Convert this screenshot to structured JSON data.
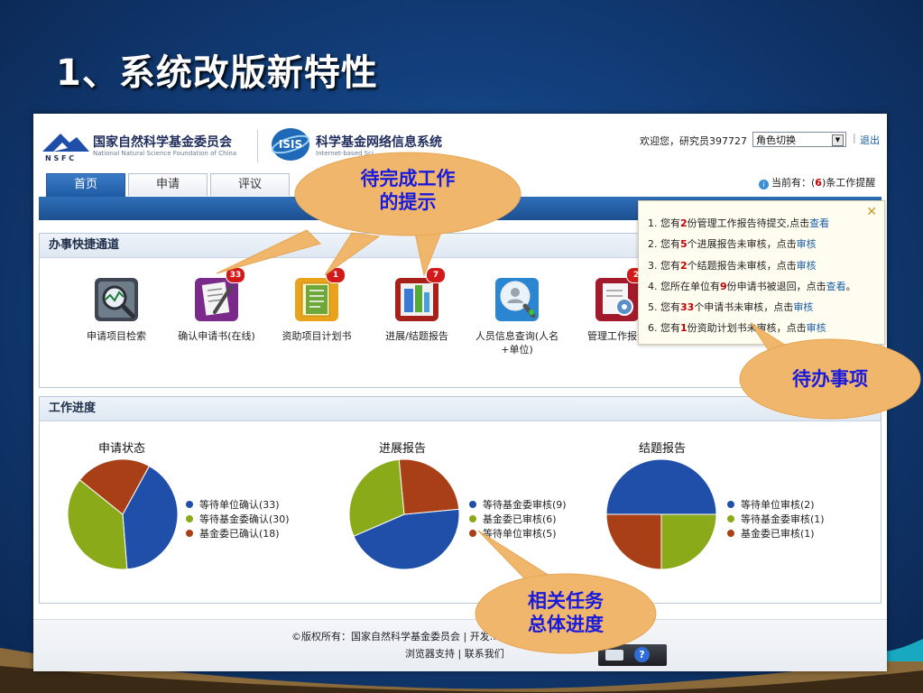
{
  "slide": {
    "title": "1、系统改版新特性"
  },
  "header": {
    "org_cn": "国家自然科学基金委员会",
    "org_en": "National Natural Science Foundation of China",
    "nsfc_label": "N S F C",
    "isis_label": "ISIS",
    "system_cn": "科学基金网络信息系统",
    "system_en": "Internet-based Sci...",
    "welcome": "欢迎您，研究员397727",
    "role_select": "角色切换",
    "logout": "退出"
  },
  "tabs": [
    {
      "label": "首页",
      "active": true
    },
    {
      "label": "申请"
    },
    {
      "label": "评议"
    }
  ],
  "reminder": {
    "prefix": "当前有：(",
    "count": "6",
    "suffix": ")条工作提醒"
  },
  "reminder_panel": {
    "items": [
      {
        "num": "1.",
        "pre": "您有",
        "n": "2",
        "post": "份管理工作报告待提交,点击",
        "link": "查看",
        "end": ""
      },
      {
        "num": "2.",
        "pre": "您有",
        "n": "5",
        "post": "个进展报告未审核，点击",
        "link": "审核",
        "end": ""
      },
      {
        "num": "3.",
        "pre": "您有",
        "n": "2",
        "post": "个结题报告未审核，点击",
        "link": "审核",
        "end": ""
      },
      {
        "num": "4.",
        "pre": "您所在单位有",
        "n": "9",
        "post": "份申请书被退回，点击",
        "link": "查看",
        "end": "。"
      },
      {
        "num": "5.",
        "pre": "您有",
        "n": "33",
        "post": "个申请书未审核，点击",
        "link": "审核",
        "end": ""
      },
      {
        "num": "6.",
        "pre": "您有",
        "n": "1",
        "post": "份资助计划书未审核，点击",
        "link": "审核",
        "end": ""
      }
    ]
  },
  "shortcuts": {
    "title": "办事快捷通道",
    "items": [
      {
        "label": "申请项目检索",
        "badge": ""
      },
      {
        "label": "确认申请书(在线)",
        "badge": "33"
      },
      {
        "label": "资助项目计划书",
        "badge": "1"
      },
      {
        "label": "进展/结题报告",
        "badge": "7"
      },
      {
        "label": "人员信息查询(人名+单位)",
        "badge": ""
      },
      {
        "label": "管理工作报告",
        "badge": "2"
      }
    ]
  },
  "progress": {
    "title": "工作进度"
  },
  "chart_data": [
    {
      "type": "pie",
      "title": "申请状态",
      "categories": [
        "等待单位确认(33)",
        "等待基金委确认(30)",
        "基金委已确认(18)"
      ],
      "values": [
        33,
        30,
        18
      ],
      "colors": [
        "#1f4fa8",
        "#8aaa1a",
        "#a83f16"
      ],
      "legend": "right"
    },
    {
      "type": "pie",
      "title": "进展报告",
      "categories": [
        "等待基金委审核(9)",
        "基金委已审核(6)",
        "等待单位审核(5)"
      ],
      "values": [
        9,
        6,
        5
      ],
      "colors": [
        "#1f4fa8",
        "#8aaa1a",
        "#a83f16"
      ],
      "legend": "right"
    },
    {
      "type": "pie",
      "title": "结题报告",
      "categories": [
        "等待单位审核(2)",
        "等待基金委审核(1)",
        "基金委已审核(1)"
      ],
      "values": [
        2,
        1,
        1
      ],
      "colors": [
        "#1f4fa8",
        "#8aaa1a",
        "#a83f16"
      ],
      "legend": "right"
    }
  ],
  "footer": {
    "copyright": "©版权所有：国家自然科学基金委员会 | 开发...",
    "browser_support": "浏览器支持",
    "divider": " | ",
    "contact": "联系我们"
  },
  "callouts": {
    "todo_tip": "待完成工作\n的提示",
    "pending": "待办事项",
    "progress": "相关任务\n总体进度"
  },
  "colors": {
    "bubble": "#f0b76c",
    "accent": "#1d5aa3",
    "alert": "#c00000",
    "callout_text": "#1a1adc"
  }
}
